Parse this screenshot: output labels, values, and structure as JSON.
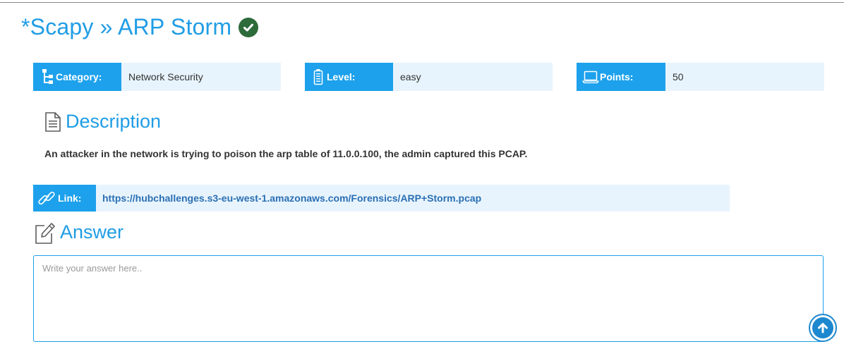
{
  "challenge": {
    "title": "*Scapy » ARP Storm",
    "solved_icon": "check-circle-icon",
    "status_color": "#2e6b3b"
  },
  "info": {
    "category": {
      "label": "Category:",
      "value": "Network Security",
      "icon": "sitemap-icon"
    },
    "level": {
      "label": "Level:",
      "value": "easy",
      "icon": "battery-icon"
    },
    "points": {
      "label": "Points:",
      "value": "50",
      "icon": "laptop-icon"
    }
  },
  "description": {
    "heading": "Description",
    "icon": "document-icon",
    "text": "An attacker in the network is trying to poison the arp table of 11.0.0.100, the admin captured this PCAP."
  },
  "link": {
    "label": "Link:",
    "icon": "chain-link-icon",
    "url": "https://hubchallenges.s3-eu-west-1.amazonaws.com/Forensics/ARP+Storm.pcap"
  },
  "answer": {
    "heading": "Answer",
    "icon": "edit-icon",
    "placeholder": "Write your answer here..",
    "value": "",
    "submit_icon": "arrow-up-circle-icon"
  },
  "colors": {
    "accent": "#1da1ec",
    "title": "#1f9de5",
    "value_bg": "#e8f4fd",
    "link_text": "#2a6fb3"
  }
}
